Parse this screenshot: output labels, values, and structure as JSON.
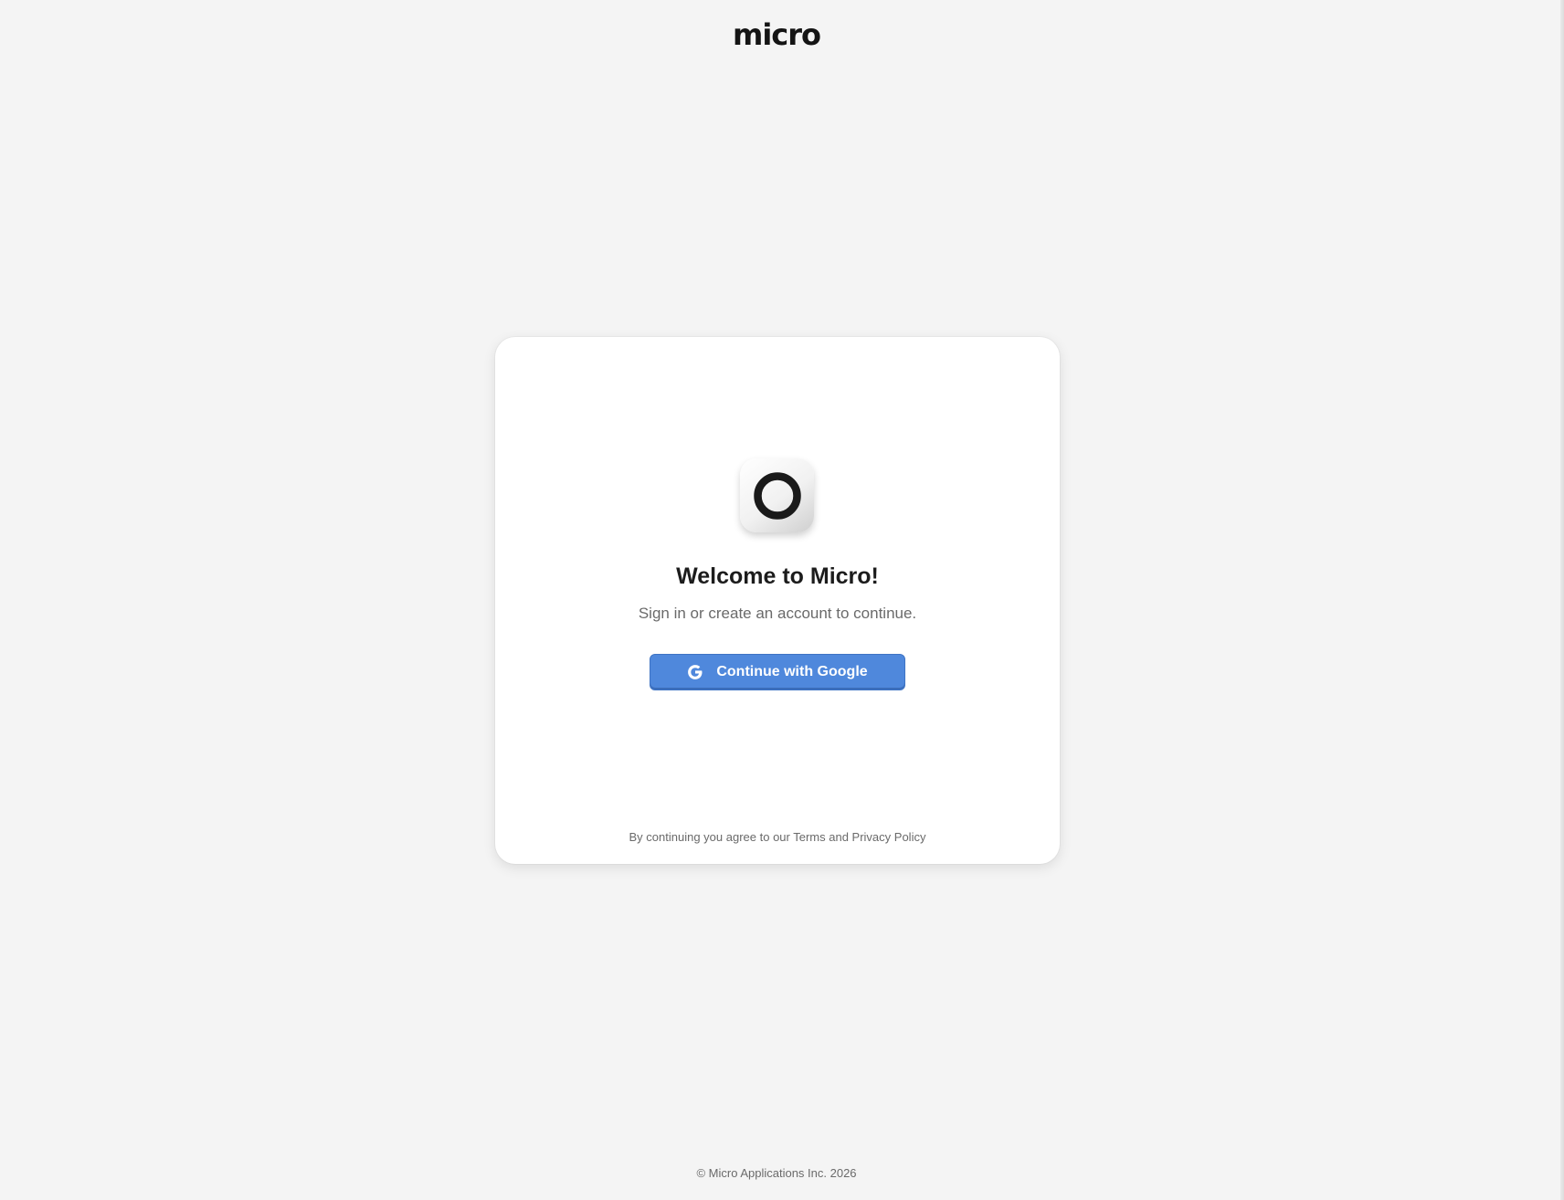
{
  "header": {
    "logo_text": "micro"
  },
  "card": {
    "app_icon": "micro-app-icon",
    "title": "Welcome to Micro!",
    "subtitle": "Sign in or create an account to continue.",
    "google_button": {
      "icon": "google-g-icon",
      "label": "Continue with Google",
      "color": "#4f88dc"
    },
    "legal": {
      "prefix": "By continuing you agree to our ",
      "terms_link": "Terms",
      "conjunction": " and ",
      "privacy_link": "Privacy Policy"
    }
  },
  "footer": {
    "copyright": "© Micro Applications Inc. 2026"
  }
}
